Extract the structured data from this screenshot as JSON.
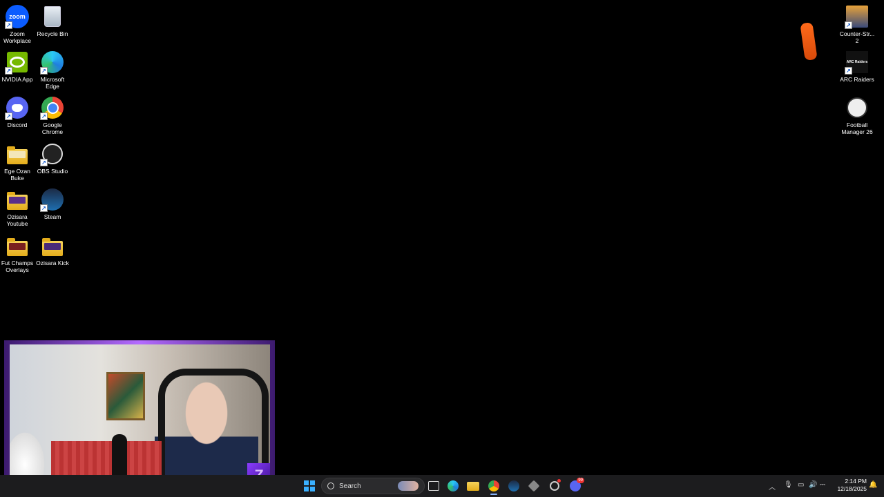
{
  "desktop": {
    "left_icons": [
      {
        "label": "Zoom Workplace"
      },
      {
        "label": "Recycle Bin"
      },
      {
        "label": "NVIDIA App"
      },
      {
        "label": "Microsoft Edge"
      },
      {
        "label": "Discord"
      },
      {
        "label": "Google Chrome"
      },
      {
        "label": "Ege Ozan Buke"
      },
      {
        "label": "OBS Studio"
      },
      {
        "label": "Ozisara Youtube"
      },
      {
        "label": "Steam"
      },
      {
        "label": "Fut Champs Overlays"
      },
      {
        "label": "Ozisara Kick"
      }
    ],
    "right_icons": [
      {
        "label": "Counter-Str... 2"
      },
      {
        "label": "ARC Raiders"
      },
      {
        "label": "Football Manager 26"
      }
    ],
    "zoom_logo_text": "zoom",
    "arc_logo_text": "ARC Raiders"
  },
  "taskbar": {
    "search_label": "Search",
    "discord_badge": "99",
    "clock_time": "2:14 PM",
    "clock_date": "12/18/2025",
    "tray_icons": [
      "chevron-up-icon",
      "microphone-icon",
      "display-icon",
      "volume-icon",
      "network-icon",
      "notification-icon"
    ],
    "pinned": [
      "windows-start-icon",
      "search",
      "widgets-icon",
      "task-view-icon",
      "edge-icon",
      "file-explorer-icon",
      "chrome-icon",
      "steam-icon",
      "app-icon",
      "nvidia-icon",
      "discord-icon"
    ]
  },
  "colors": {
    "accent_purple": "#b46bff",
    "taskbar_bg": "#1c1c1e",
    "desktop_bg": "#000000"
  }
}
